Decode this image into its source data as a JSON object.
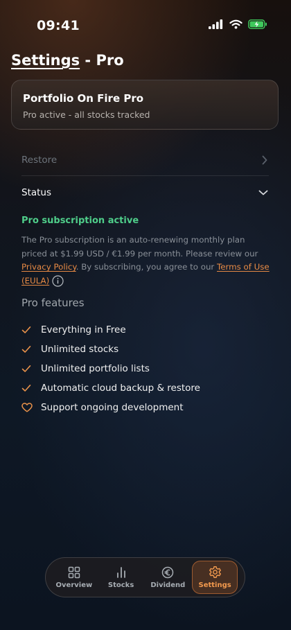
{
  "status_bar": {
    "time": "09:41"
  },
  "header": {
    "crumb": "Settings",
    "separator": " - ",
    "title": "Pro"
  },
  "pro_card": {
    "title": "Portfolio On Fire Pro",
    "subtitle": "Pro active - all stocks tracked"
  },
  "rows": {
    "restore": "Restore",
    "status": "Status"
  },
  "status_section": {
    "active_label": "Pro subscription active",
    "desc_prefix": "The Pro subscription is an auto-renewing monthly plan priced at $1.99 USD / €1.99 per month. Please review our ",
    "privacy_link": "Privacy Policy",
    "desc_mid": ". By subscribing, you agree to our ",
    "terms_link": "Terms of Use (EULA)"
  },
  "features": {
    "title": "Pro features",
    "items": [
      {
        "label": "Everything in Free",
        "icon": "check-icon"
      },
      {
        "label": "Unlimited stocks",
        "icon": "check-icon"
      },
      {
        "label": "Unlimited portfolio lists",
        "icon": "check-icon"
      },
      {
        "label": "Automatic cloud backup & restore",
        "icon": "check-icon"
      },
      {
        "label": "Support ongoing development",
        "icon": "heart-icon"
      }
    ]
  },
  "tabs": [
    {
      "label": "Overview",
      "icon": "grid-icon"
    },
    {
      "label": "Stocks",
      "icon": "bar-chart-icon"
    },
    {
      "label": "Dividend",
      "icon": "euro-icon"
    },
    {
      "label": "Settings",
      "icon": "gear-icon",
      "active": true
    }
  ],
  "colors": {
    "accent": "#f39a4e",
    "success": "#4fce8a",
    "link": "#e98b45",
    "battery": "#3fc95c"
  }
}
